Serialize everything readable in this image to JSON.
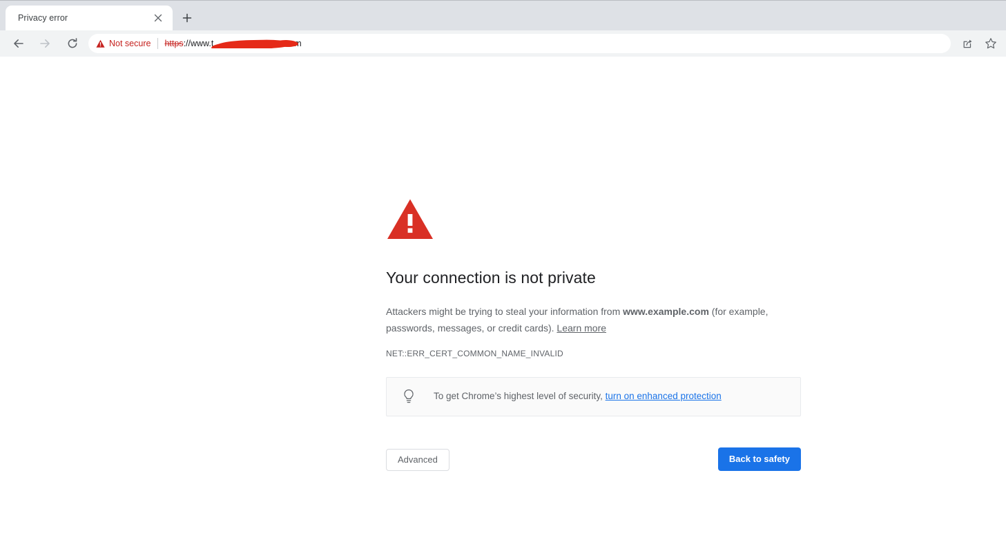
{
  "browser": {
    "tab": {
      "title": "Privacy error",
      "close_icon": "close-icon",
      "favicon": "none"
    },
    "new_tab_icon": "plus-icon",
    "nav": {
      "back_icon": "back-arrow-icon",
      "forward_icon": "forward-arrow-icon",
      "reload_icon": "reload-icon"
    },
    "omnibox": {
      "security_icon": "warning-triangle-icon",
      "security_label": "Not secure",
      "security_color": "#c5221f",
      "url_scheme": "https",
      "url_separator": "://",
      "url_host_visible_prefix": "www.",
      "url_host_suffix": ".com",
      "url_redacted": true,
      "url_full_display": "https://www.██████████.com",
      "redaction_color": "#e52a18"
    },
    "actions": [
      {
        "name": "share-icon",
        "label": "Share this page"
      },
      {
        "name": "star-icon",
        "label": "Bookmark this tab"
      }
    ],
    "colors": {
      "tabstrip_bg": "#dee1e6",
      "toolbar_bg": "#f1f3f4",
      "omnibox_bg": "#ffffff"
    }
  },
  "interstitial": {
    "icon": "error-triangle-icon",
    "icon_color": "#d93025",
    "heading": "Your connection is not private",
    "body_prefix": "Attackers might be trying to steal your information from ",
    "body_domain": "www.example.com",
    "body_suffix": " (for example, passwords, messages, or credit cards). ",
    "learn_more_label": "Learn more",
    "error_code": "NET::ERR_CERT_COMMON_NAME_INVALID",
    "enhanced_protection": {
      "icon": "lightbulb-icon",
      "text": "To get Chrome’s highest level of security, ",
      "link_label": "turn on enhanced protection",
      "link_color": "#1a73e8"
    },
    "buttons": {
      "advanced_label": "Advanced",
      "back_to_safety_label": "Back to safety",
      "primary_color": "#1a73e8"
    }
  }
}
